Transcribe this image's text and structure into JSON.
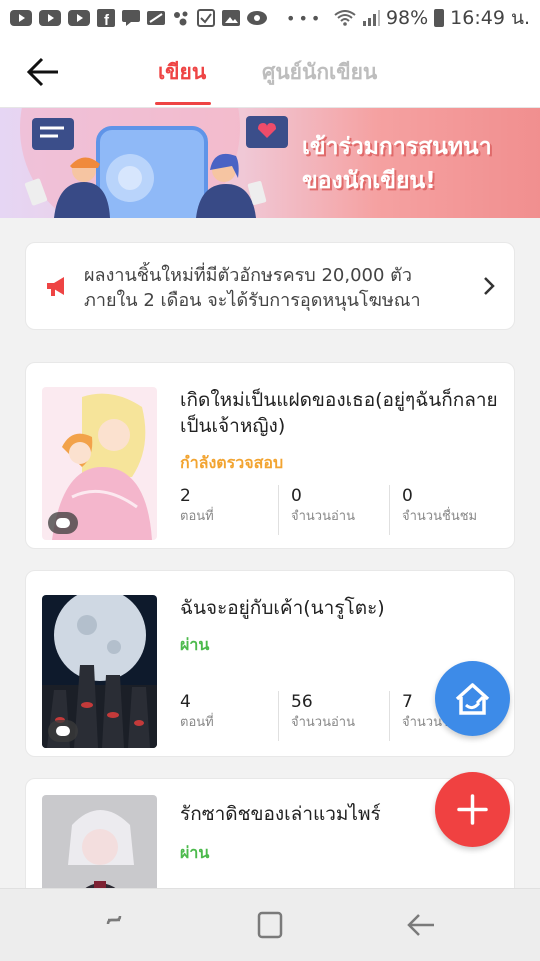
{
  "status_bar": {
    "battery": "98%",
    "time": "16:49 น.",
    "icons": [
      "youtube-icon",
      "youtube-icon",
      "youtube-icon",
      "facebook-icon",
      "chat-icon",
      "image-icon",
      "assistant-icon",
      "checkbox-icon",
      "gallery-icon",
      "viber-icon",
      "more-dots-icon",
      "wifi-icon",
      "signal-icon",
      "battery-icon"
    ]
  },
  "header": {
    "tabs": [
      {
        "label": "เขียน",
        "active": true
      },
      {
        "label": "ศูนย์นักเขียน",
        "active": false
      }
    ]
  },
  "banner": {
    "text": "เข้าร่วมการสนทนาของนักเขียน!"
  },
  "notice": {
    "text": "ผลงานชิ้นใหม่ที่มีตัวอักษรครบ 20,000 ตัว ภายใน 2 เดือน จะได้รับการอุดหนุนโฆษณา"
  },
  "works": [
    {
      "title": "เกิดใหม่เป็นแฝดของเธอ(อยู่ๆฉันก็กลายเป็นเจ้าหญิง)",
      "status": "กำลังตรวจสอบ",
      "status_color": "#f2a431",
      "stats": [
        {
          "value": "2",
          "label": "ตอนที่"
        },
        {
          "value": "0",
          "label": "จำนวนอ่าน"
        },
        {
          "value": "0",
          "label": "จำนวนชื่นชม"
        }
      ]
    },
    {
      "title": "ฉันจะอยู่กับเค้า(นารูโตะ)",
      "status": "ผ่าน",
      "status_color": "#4cba4c",
      "stats": [
        {
          "value": "4",
          "label": "ตอนที่"
        },
        {
          "value": "56",
          "label": "จำนวนอ่าน"
        },
        {
          "value": "7",
          "label": "จำนวนชื่นชม"
        }
      ]
    },
    {
      "title": "รักซาดิชของเล่าแวมไพร์",
      "status": "ผ่าน",
      "status_color": "#4cba4c",
      "stats": []
    }
  ],
  "colors": {
    "accent": "#ee4444",
    "fab_home": "#3d8be8",
    "fab_add": "#f04141"
  }
}
